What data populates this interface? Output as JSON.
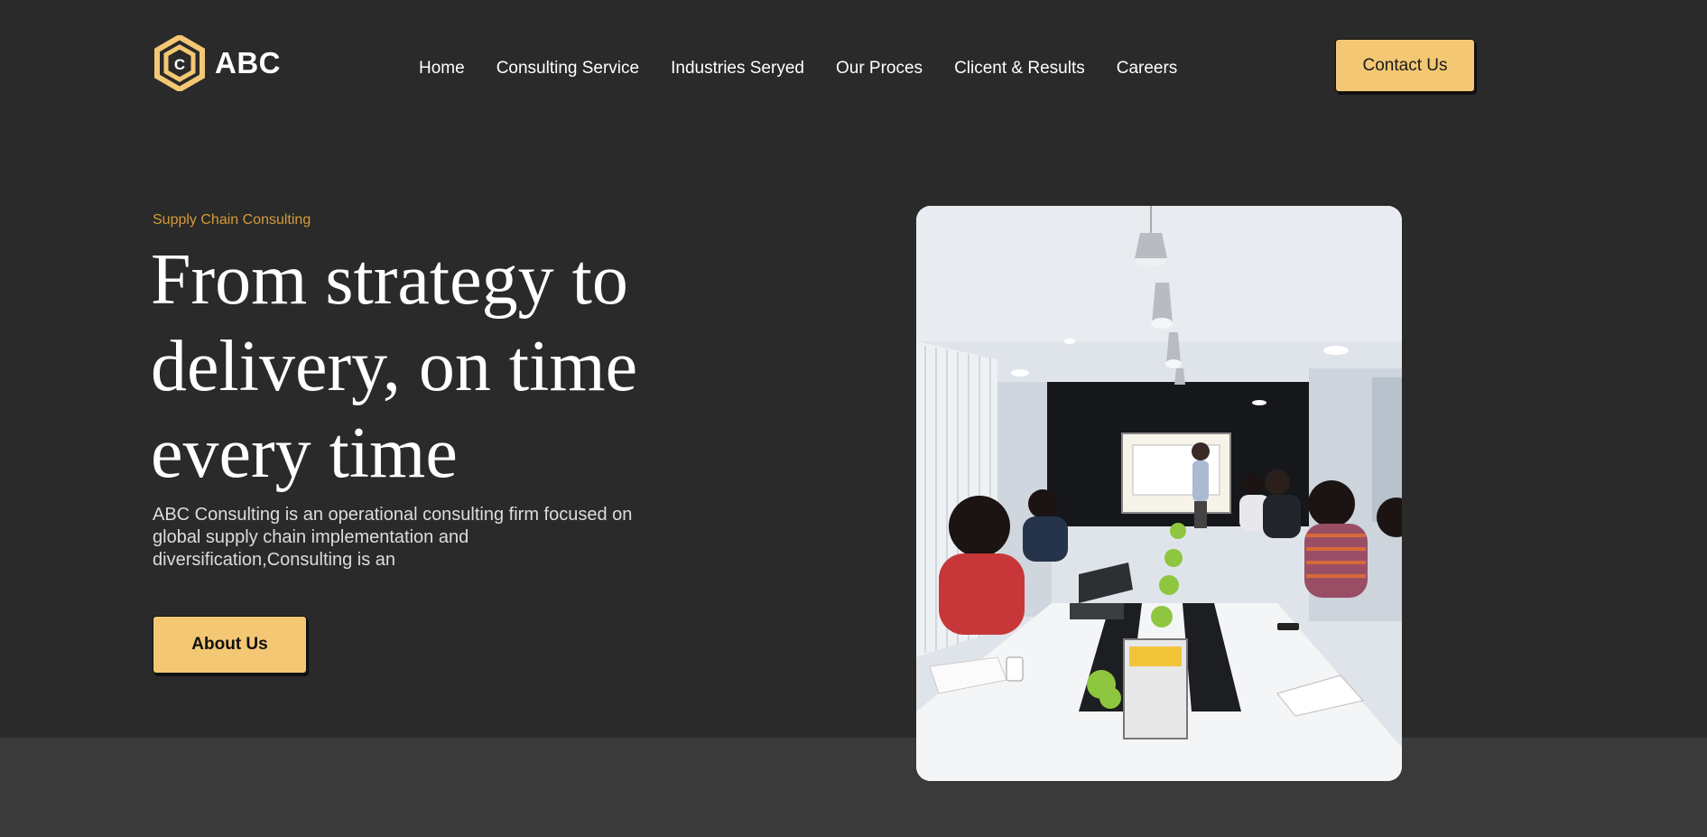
{
  "header": {
    "logo_text": "ABC",
    "logo_letter": "C",
    "nav": [
      "Home",
      "Consulting Service",
      "Industries Seryed",
      "Our Proces",
      "Clicent & Results",
      "Careers"
    ],
    "contact_label": "Contact Us"
  },
  "hero": {
    "eyebrow": "Supply Chain Consulting",
    "headline_lines": [
      "From strategy to",
      "delivery, on time",
      "every time"
    ],
    "description": "ABC Consulting is an operational consulting firm focused on global supply chain implementation and diversification,Consulting is an",
    "about_label": "About Us"
  },
  "colors": {
    "background": "#2a2a2a",
    "band": "#3a3a3a",
    "accent": "#f3c774",
    "eyebrow": "#d49a3a"
  }
}
